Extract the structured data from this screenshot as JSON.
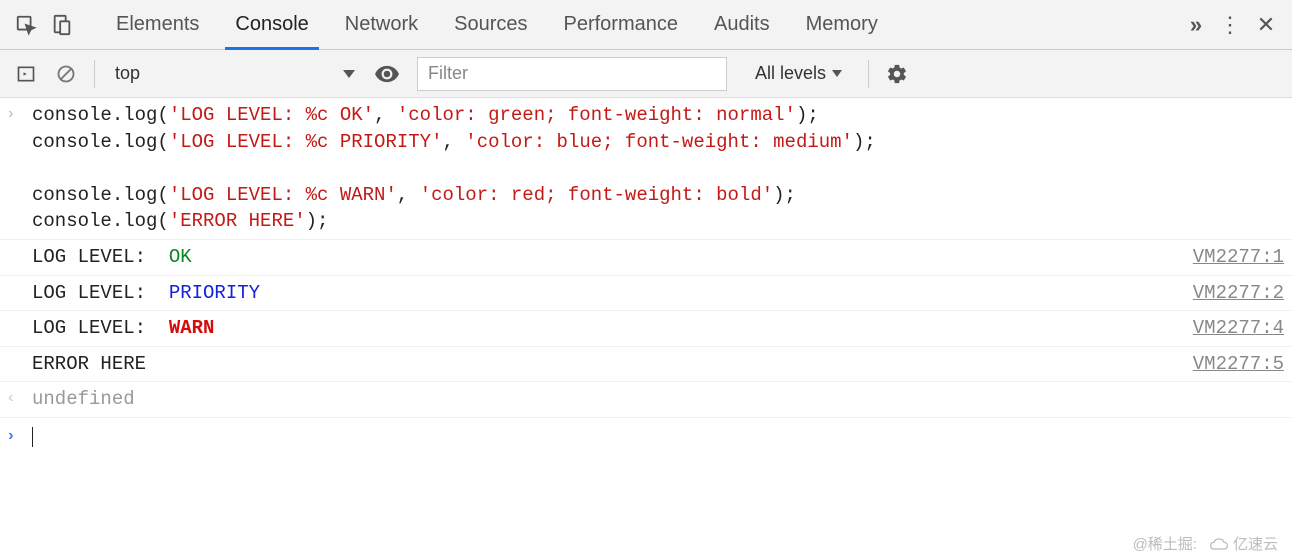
{
  "tabs": {
    "elements": "Elements",
    "console": "Console",
    "network": "Network",
    "sources": "Sources",
    "performance": "Performance",
    "audits": "Audits",
    "memory": "Memory"
  },
  "toolbar": {
    "context": "top",
    "filter_placeholder": "Filter",
    "levels_label": "All levels"
  },
  "input_code": {
    "line1_a": "console.log(",
    "line1_b": "'LOG LEVEL: %c OK'",
    "line1_c": ", ",
    "line1_d": "'color: green; font-weight: normal'",
    "line1_e": ");",
    "line2_a": "console.log(",
    "line2_b": "'LOG LEVEL: %c PRIORITY'",
    "line2_c": ", ",
    "line2_d": "'color: blue; font-weight: medium'",
    "line2_e": ");",
    "line3_a": "console.log(",
    "line3_b": "'LOG LEVEL: %c WARN'",
    "line3_c": ", ",
    "line3_d": "'color: red; font-weight: bold'",
    "line3_e": ");",
    "line4_a": "console.log(",
    "line4_b": "'ERROR HERE'",
    "line4_c": ");"
  },
  "log_output": [
    {
      "prefix": "LOG LEVEL:  ",
      "msg": "OK",
      "style": "ok",
      "src": "VM2277:1"
    },
    {
      "prefix": "LOG LEVEL:  ",
      "msg": "PRIORITY",
      "style": "priority",
      "src": "VM2277:2"
    },
    {
      "prefix": "LOG LEVEL:  ",
      "msg": "WARN",
      "style": "warn",
      "src": "VM2277:4"
    },
    {
      "prefix": "ERROR HERE",
      "msg": "",
      "style": "",
      "src": "VM2277:5"
    }
  ],
  "return_value": "undefined",
  "watermark": {
    "left": "@稀土掘:",
    "right": "亿速云"
  }
}
